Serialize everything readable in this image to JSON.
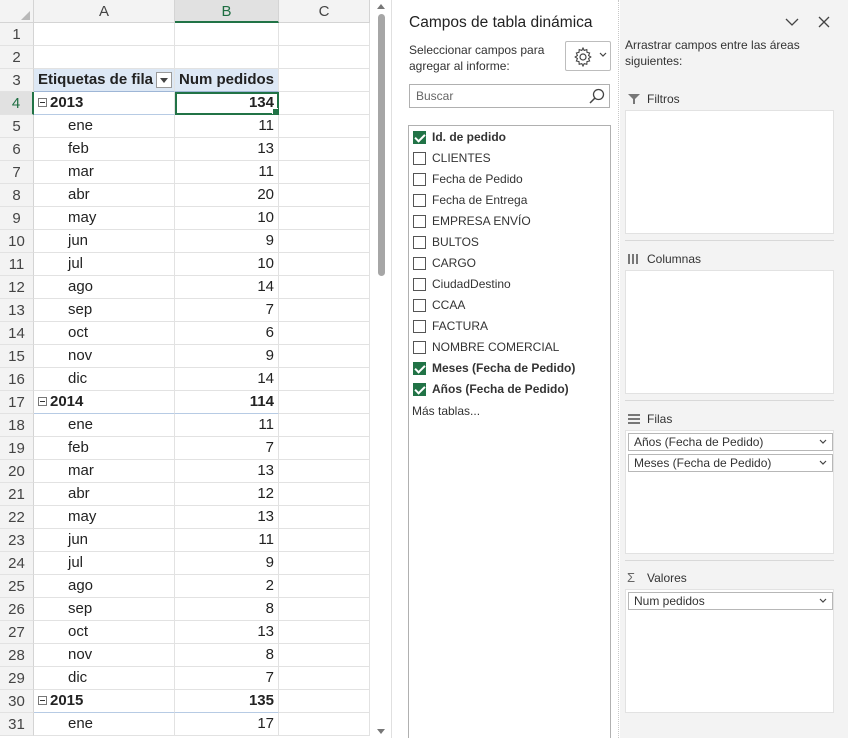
{
  "sheet": {
    "columns": [
      "A",
      "B",
      "C"
    ],
    "selected_column": "B",
    "selected_row": "4",
    "header": {
      "row_label": "Etiquetas de fila",
      "value_label": "Num pedidos"
    },
    "rows": [
      {
        "n": "1",
        "kind": "blank"
      },
      {
        "n": "2",
        "kind": "blank"
      },
      {
        "n": "3",
        "kind": "header"
      },
      {
        "n": "4",
        "kind": "year",
        "label": "2013",
        "value": "134"
      },
      {
        "n": "5",
        "kind": "month",
        "label": "ene",
        "value": "11"
      },
      {
        "n": "6",
        "kind": "month",
        "label": "feb",
        "value": "13"
      },
      {
        "n": "7",
        "kind": "month",
        "label": "mar",
        "value": "11"
      },
      {
        "n": "8",
        "kind": "month",
        "label": "abr",
        "value": "20"
      },
      {
        "n": "9",
        "kind": "month",
        "label": "may",
        "value": "10"
      },
      {
        "n": "10",
        "kind": "month",
        "label": "jun",
        "value": "9"
      },
      {
        "n": "11",
        "kind": "month",
        "label": "jul",
        "value": "10"
      },
      {
        "n": "12",
        "kind": "month",
        "label": "ago",
        "value": "14"
      },
      {
        "n": "13",
        "kind": "month",
        "label": "sep",
        "value": "7"
      },
      {
        "n": "14",
        "kind": "month",
        "label": "oct",
        "value": "6"
      },
      {
        "n": "15",
        "kind": "month",
        "label": "nov",
        "value": "9"
      },
      {
        "n": "16",
        "kind": "month",
        "label": "dic",
        "value": "14"
      },
      {
        "n": "17",
        "kind": "year",
        "label": "2014",
        "value": "114"
      },
      {
        "n": "18",
        "kind": "month",
        "label": "ene",
        "value": "11"
      },
      {
        "n": "19",
        "kind": "month",
        "label": "feb",
        "value": "7"
      },
      {
        "n": "20",
        "kind": "month",
        "label": "mar",
        "value": "13"
      },
      {
        "n": "21",
        "kind": "month",
        "label": "abr",
        "value": "12"
      },
      {
        "n": "22",
        "kind": "month",
        "label": "may",
        "value": "13"
      },
      {
        "n": "23",
        "kind": "month",
        "label": "jun",
        "value": "11"
      },
      {
        "n": "24",
        "kind": "month",
        "label": "jul",
        "value": "9"
      },
      {
        "n": "25",
        "kind": "month",
        "label": "ago",
        "value": "2"
      },
      {
        "n": "26",
        "kind": "month",
        "label": "sep",
        "value": "8"
      },
      {
        "n": "27",
        "kind": "month",
        "label": "oct",
        "value": "13"
      },
      {
        "n": "28",
        "kind": "month",
        "label": "nov",
        "value": "8"
      },
      {
        "n": "29",
        "kind": "month",
        "label": "dic",
        "value": "7"
      },
      {
        "n": "30",
        "kind": "year",
        "label": "2015",
        "value": "135"
      },
      {
        "n": "31",
        "kind": "month",
        "label": "ene",
        "value": "17"
      }
    ]
  },
  "pivot": {
    "title": "Campos de tabla dinámica",
    "select_fields_text": "Seleccionar campos para agregar al informe:",
    "drag_fields_text": "Arrastrar campos entre las áreas siguientes:",
    "search_placeholder": "Buscar",
    "fields": [
      {
        "label": "Id. de pedido",
        "checked": true
      },
      {
        "label": "CLIENTES",
        "checked": false
      },
      {
        "label": "Fecha de Pedido",
        "checked": false
      },
      {
        "label": "Fecha de Entrega",
        "checked": false
      },
      {
        "label": "EMPRESA ENVÍO",
        "checked": false
      },
      {
        "label": "BULTOS",
        "checked": false
      },
      {
        "label": "CARGO",
        "checked": false
      },
      {
        "label": "CiudadDestino",
        "checked": false
      },
      {
        "label": "CCAA",
        "checked": false
      },
      {
        "label": "FACTURA",
        "checked": false
      },
      {
        "label": "NOMBRE COMERCIAL",
        "checked": false
      },
      {
        "label": "Meses (Fecha de Pedido)",
        "checked": true
      },
      {
        "label": "Años (Fecha de Pedido)",
        "checked": true
      }
    ],
    "more_tables": "Más tablas...",
    "areas": {
      "filters": {
        "label": "Filtros",
        "items": []
      },
      "columns": {
        "label": "Columnas",
        "items": []
      },
      "rows": {
        "label": "Filas",
        "items": [
          "Años (Fecha de Pedido)",
          "Meses (Fecha de Pedido)"
        ]
      },
      "values": {
        "label": "Valores",
        "items": [
          "Num pedidos"
        ]
      }
    }
  },
  "colors": {
    "accent": "#217346",
    "pivot_header_fill": "#dde8f5",
    "panel_bg": "#f3f3f3"
  },
  "icons": [
    "collapse-pane-icon",
    "close-icon",
    "gear-icon",
    "search-icon",
    "filter-icon",
    "columns-icon",
    "rows-icon",
    "sigma-icon",
    "dropdown-arrow-icon",
    "collapse-button-icon"
  ]
}
